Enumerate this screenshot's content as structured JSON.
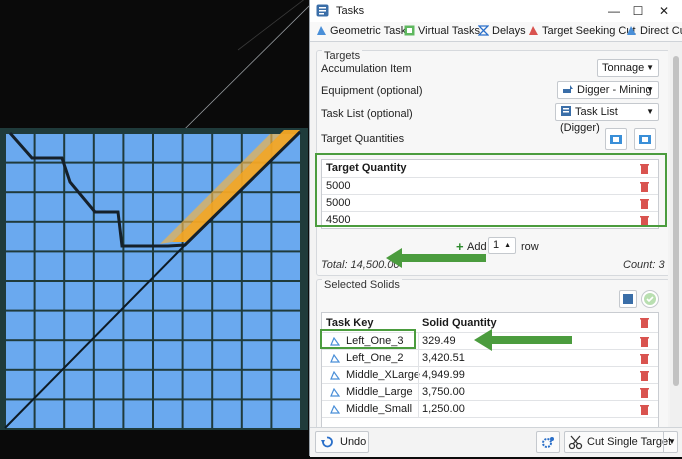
{
  "window": {
    "title": "Tasks"
  },
  "tabs": [
    {
      "label": "Geometric Tasks"
    },
    {
      "label": "Virtual Tasks"
    },
    {
      "label": "Delays"
    },
    {
      "label": "Target Seeking Cut"
    },
    {
      "label": "Direct Cut"
    }
  ],
  "targets": {
    "group_title": "Targets",
    "accumulation_label": "Accumulation Item",
    "accumulation_value": "Tonnage",
    "equipment_label": "Equipment (optional)",
    "equipment_value": "Digger - Mining",
    "tasklist_label": "Task List (optional)",
    "tasklist_value": "Task List (Digger)",
    "quantities_label": "Target Quantities",
    "table_header": "Target Quantity",
    "rows": [
      "5000",
      "5000",
      "4500"
    ],
    "add_label": "Add",
    "add_count": "1",
    "row_label": "row",
    "total": "Total: 14,500.00",
    "count": "Count: 3"
  },
  "solids": {
    "group_title": "Selected Solids",
    "col_key": "Task Key",
    "col_qty": "Solid Quantity",
    "rows": [
      {
        "key": "Left_One_3",
        "qty": "329.49"
      },
      {
        "key": "Left_One_2",
        "qty": "3,420.51"
      },
      {
        "key": "Middle_XLarge",
        "qty": "4,949.99"
      },
      {
        "key": "Middle_Large",
        "qty": "3,750.00"
      },
      {
        "key": "Middle_Small",
        "qty": "1,250.00"
      }
    ]
  },
  "footer": {
    "undo_label": "Undo",
    "cut_label": "Cut Single Target"
  },
  "colors": {
    "highlight": "#4b9c3e",
    "block": "#6aa9ef",
    "accent": "#f5a623",
    "delete": "#d9534f"
  }
}
